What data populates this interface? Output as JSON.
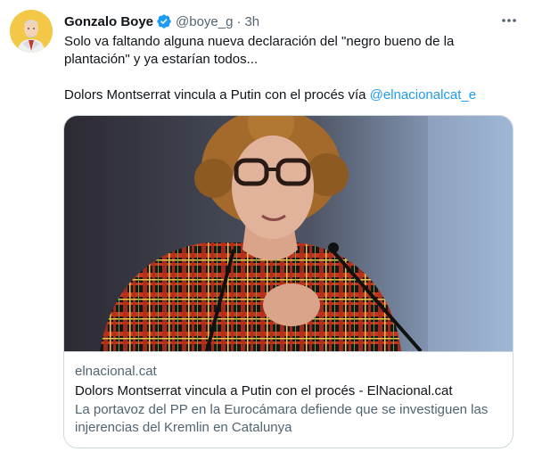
{
  "tweet": {
    "author_name": "Gonzalo Boye",
    "handle": "@boye_g",
    "separator": "·",
    "time": "3h",
    "text_line1": "Solo va faltando alguna nueva declaración del \"negro bueno de la",
    "text_line2": "plantación\" y ya estarían todos...",
    "text_link_prefix": "Dolors Montserrat vincula a Putin con el procés vía ",
    "mention": "@elnacionalcat_e",
    "icons": [
      "avatar",
      "verified-badge-icon",
      "more-options-icon"
    ],
    "accent_color": "#1d9bf0"
  },
  "card": {
    "domain": "elnacional.cat",
    "title": "Dolors Montserrat vincula a Putin con el procés - ElNacional.cat",
    "description_line1": "La portavoz del PP en la Eurocámara defiende que se investiguen las",
    "description_line2": "injerencias del Kremlin en Catalunya"
  }
}
